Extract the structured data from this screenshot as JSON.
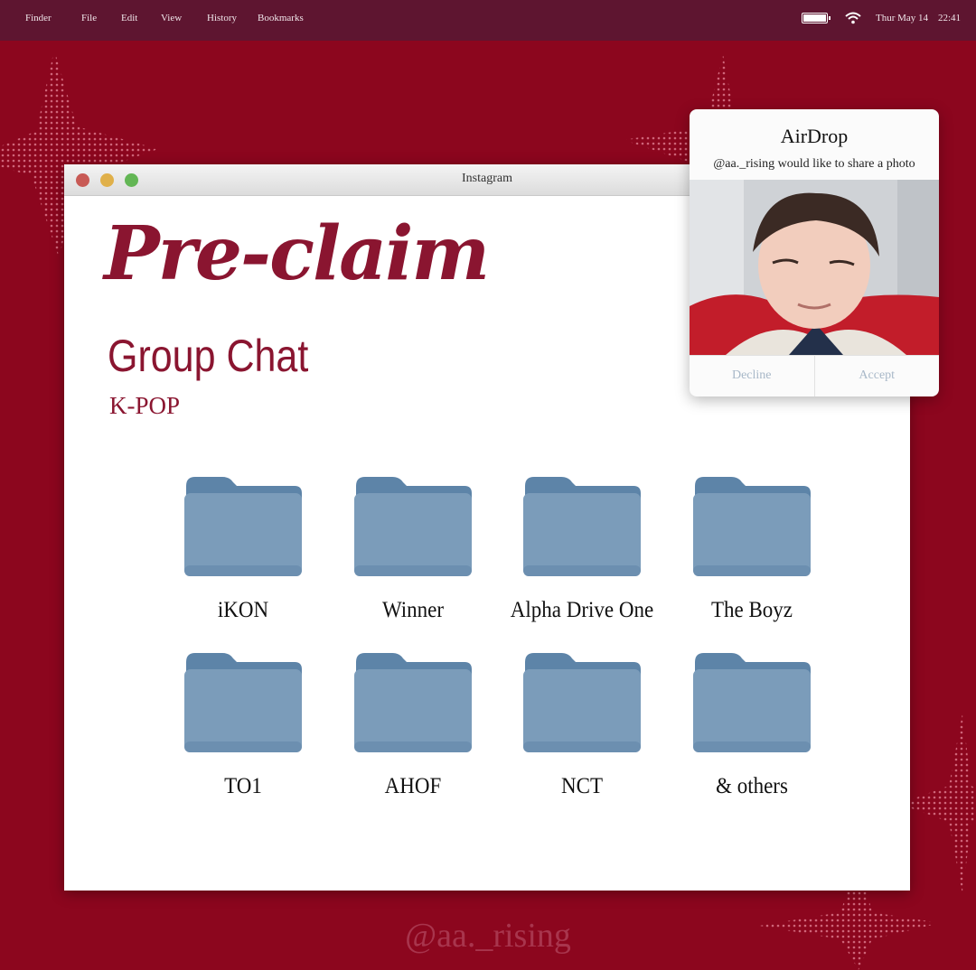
{
  "menubar": {
    "items": [
      "Finder",
      "File",
      "Edit",
      "View",
      "History",
      "Bookmarks"
    ],
    "date": "Thur May 14",
    "time": "22:41",
    "battery_icon": "battery-icon",
    "wifi_icon": "wifi-icon"
  },
  "window": {
    "title": "Instagram",
    "heading": "Pre-claim",
    "subheading": "Group Chat",
    "tag": "K-POP"
  },
  "folders": [
    {
      "label": "iKON",
      "icon": "folder-icon"
    },
    {
      "label": "Winner",
      "icon": "folder-icon"
    },
    {
      "label": "Alpha Drive One",
      "icon": "folder-icon"
    },
    {
      "label": "The Boyz",
      "icon": "folder-icon"
    },
    {
      "label": "TO1",
      "icon": "folder-icon"
    },
    {
      "label": "AHOF",
      "icon": "folder-icon"
    },
    {
      "label": "NCT",
      "icon": "folder-icon"
    },
    {
      "label": "& others",
      "icon": "folder-icon"
    }
  ],
  "airdrop": {
    "title": "AirDrop",
    "message": "@aa._rising would like to share a photo",
    "decline_label": "Decline",
    "accept_label": "Accept"
  },
  "watermark": "@aa._rising",
  "colors": {
    "background": "#8c061e",
    "menubar": "#5e1530",
    "accent_text": "#8a1530",
    "folder": "#7b9cba",
    "folder_tab": "#5d84a8"
  }
}
